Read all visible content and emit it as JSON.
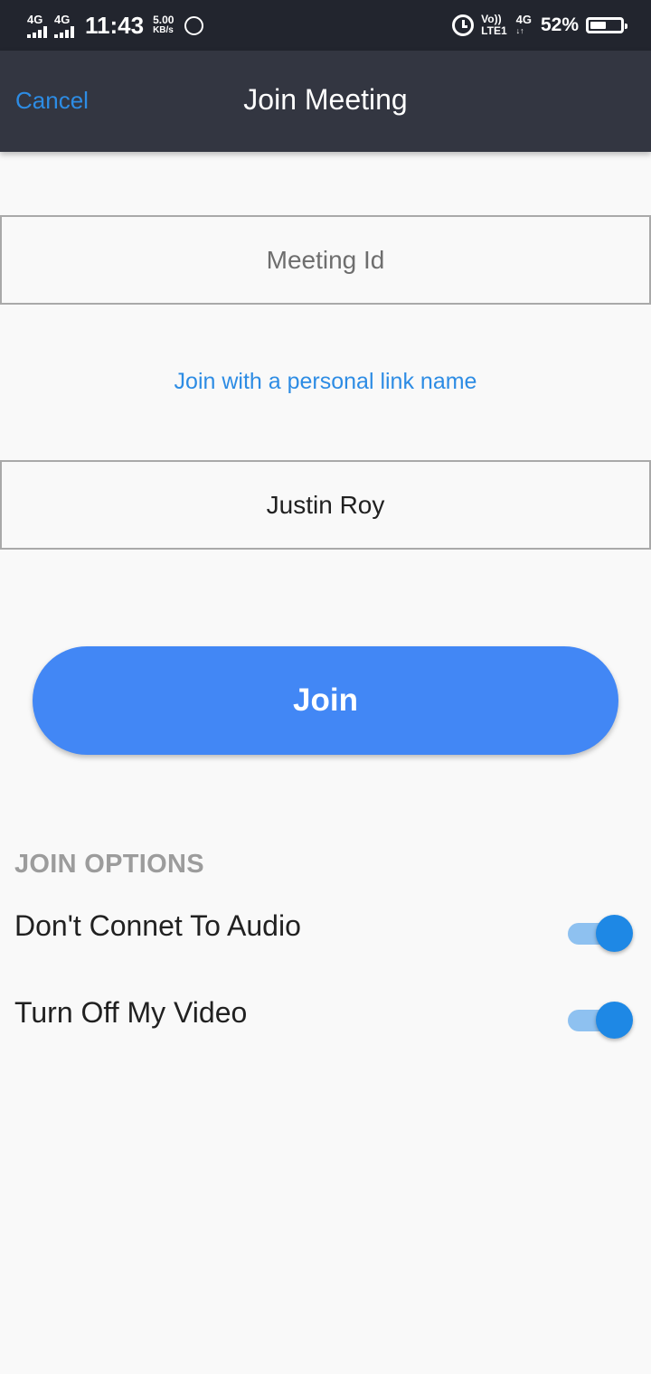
{
  "status_bar": {
    "sim1_network": "4G",
    "sim2_network": "4G",
    "time": "11:43",
    "speed_value": "5.00",
    "speed_unit": "KB/s",
    "volte_top": "Vo))",
    "volte_bottom": "LTE1",
    "data_network": "4G",
    "data_arrows": "↓↑",
    "battery_percent": "52%",
    "battery_level": 0.52
  },
  "header": {
    "cancel_label": "Cancel",
    "title": "Join Meeting"
  },
  "form": {
    "meeting_id_placeholder": "Meeting Id",
    "meeting_id_value": "",
    "personal_link_label": "Join with a personal link name",
    "name_value": "Justin Roy",
    "join_label": "Join"
  },
  "options": {
    "heading": "JOIN OPTIONS",
    "items": [
      {
        "label": "Don't Connet To Audio",
        "enabled": true
      },
      {
        "label": "Turn Off My Video",
        "enabled": true
      }
    ]
  },
  "colors": {
    "accent": "#2d8ce4",
    "join_button": "#4287f5",
    "toggle_on": "#1e88e5",
    "app_bar": "#333641"
  }
}
